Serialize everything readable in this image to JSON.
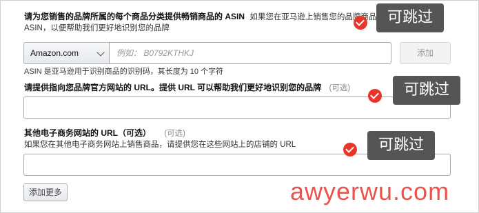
{
  "colors": {
    "accent_red": "#e8352a",
    "bubble_bg": "#555555",
    "field_border": "#a6a6a6"
  },
  "section1": {
    "label": "请为您销售的品牌所属的每个商品分类提供畅销商品的 ASIN",
    "note_inline": "如果您在亚马逊上销售您的品牌商品",
    "note_line2": "ASIN，以便帮助我们更好地识别您的品牌",
    "select_value": "Amazon.com",
    "asin_placeholder": "例如：  B0792KTHKJ",
    "add_button": "添加",
    "hint": "ASIN 是亚马逊用于识别商品的识别码，其长度为 10 个字符",
    "badge": "可跳过"
  },
  "section2": {
    "label": "请提供指向您品牌官方网站的 URL。提供 URL 可以帮助我们更好地识别您的品牌",
    "optional": "(可选)",
    "badge": "可跳过"
  },
  "section3": {
    "label": "其他电子商务网站的 URL（可选）",
    "optional": "(可选)",
    "note": "如果您在其他电子商务网站上销售商品，请提供您在这些网站上的店铺的 URL",
    "badge": "可跳过"
  },
  "add_more_button": "添加更多",
  "watermark": "awyerwu.com",
  "icons": [
    "chevron-down-icon",
    "check-icon"
  ]
}
